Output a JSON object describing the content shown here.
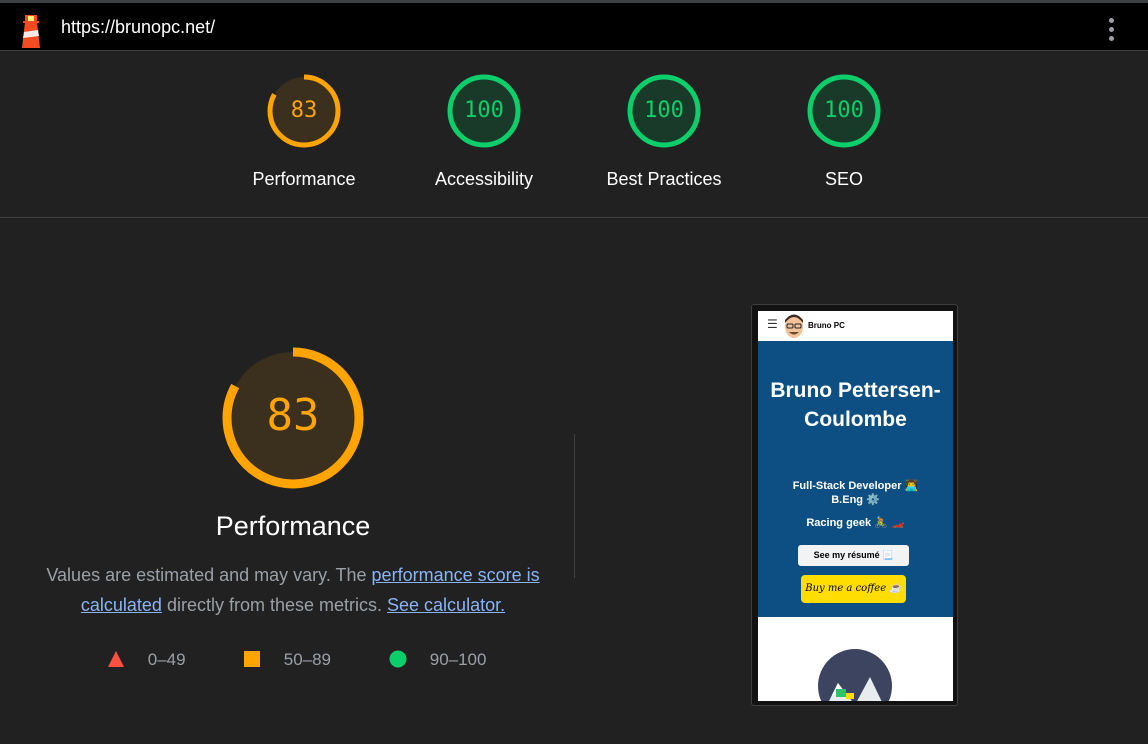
{
  "topbar": {
    "url": "https://brunopc.net/",
    "logo_icon": "lighthouse-icon",
    "menu_icon": "kebab-menu-icon"
  },
  "gauges": [
    {
      "label": "Performance",
      "score": "83",
      "value": 83,
      "color": "#ffa400",
      "track": "#3b2f1e"
    },
    {
      "label": "Accessibility",
      "score": "100",
      "value": 100,
      "color": "#0cce6b",
      "track": "#1a3a29"
    },
    {
      "label": "Best Practices",
      "score": "100",
      "value": 100,
      "color": "#0cce6b",
      "track": "#1a3a29"
    },
    {
      "label": "SEO",
      "score": "100",
      "value": 100,
      "color": "#0cce6b",
      "track": "#1a3a29"
    }
  ],
  "performance": {
    "score": "83",
    "value": 83,
    "title": "Performance",
    "desc_prefix": "Values are estimated and may vary. The ",
    "link_score": "performance score is calculated",
    "desc_middle": " directly from these metrics. ",
    "link_calc": "See calculator."
  },
  "legend": [
    {
      "range": "0–49",
      "shape": "triangle",
      "color": "#ff4e42"
    },
    {
      "range": "50–89",
      "shape": "square",
      "color": "#ffa400"
    },
    {
      "range": "90–100",
      "shape": "circle",
      "color": "#0cce6b"
    }
  ],
  "screenshot": {
    "site_name": "Bruno PC",
    "hero_title": "Bruno Pettersen-Coulombe",
    "line1": "Full-Stack Developer 👨‍💻",
    "line2": "B.Eng ⚙️",
    "line3": "Racing geek 🚴 🏎️",
    "resume_button": "See my résumé 📃",
    "coffee_button": "Buy me a coffee ☕",
    "hero_color": "#0e4f83",
    "coffee_color": "#ffdd00"
  }
}
